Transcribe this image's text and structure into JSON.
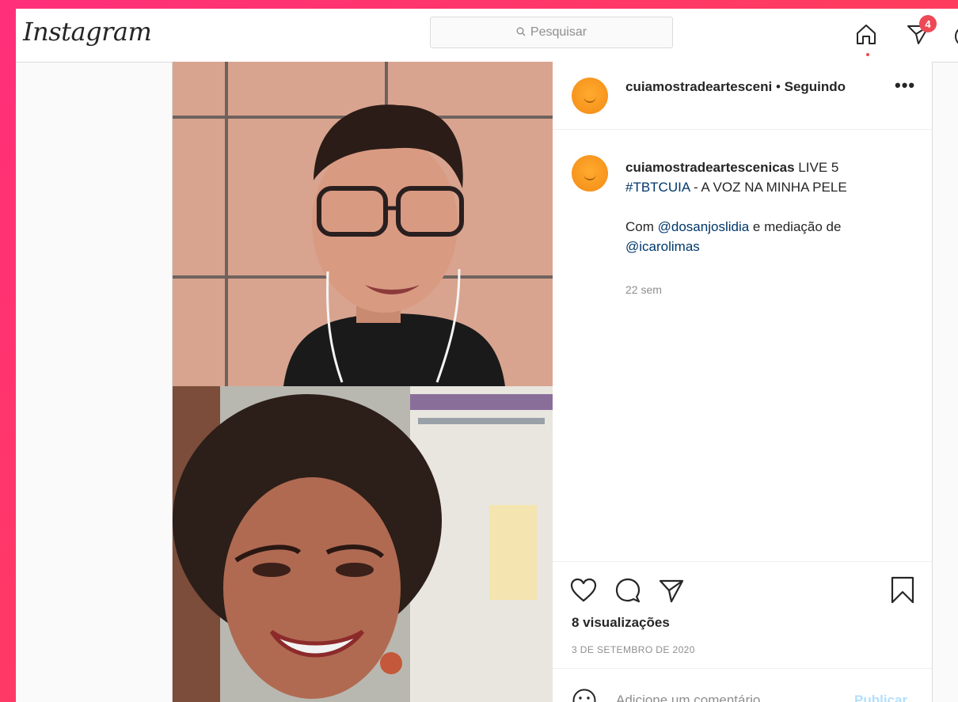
{
  "brand": {
    "logo_text": "Instagram"
  },
  "search": {
    "placeholder": "Pesquisar"
  },
  "nav": {
    "activity_badge": "4"
  },
  "post": {
    "header": {
      "username": "cuiamostradeartesceni",
      "separator": "•",
      "follow_status": "Seguindo"
    },
    "caption": {
      "username": "cuiamostradeartescenicas",
      "text_1": "LIVE 5",
      "hashtag": "#TBTCUIA",
      "text_2": "- A VOZ NA MINHA PELE",
      "text_3": "Com",
      "mention_1": "@dosanjoslidia",
      "text_4": "e mediação de",
      "mention_2": "@icarolimas",
      "time": "22 sem"
    },
    "stats": {
      "views": "8 visualizações",
      "date": "3 DE SETEMBRO DE 2020"
    },
    "comment": {
      "placeholder": "Adicione um comentário...",
      "publish_label": "Publicar"
    }
  },
  "colors": {
    "badge": "#ed4956",
    "link": "#00376b",
    "avatar": "#f7941d",
    "publish_disabled": "#b2dffc"
  }
}
